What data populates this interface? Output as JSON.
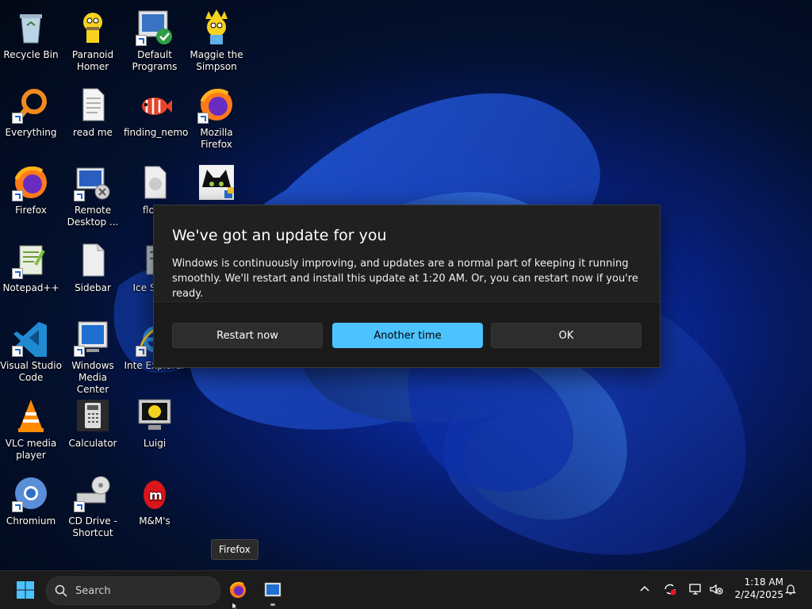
{
  "desktop": {
    "icons": [
      {
        "label": "Recycle Bin",
        "icon": "recycle-bin-icon"
      },
      {
        "label": "Paranoid Homer",
        "icon": "homer-icon"
      },
      {
        "label": "Default Programs",
        "icon": "default-programs-icon"
      },
      {
        "label": "Maggie the Simpson",
        "icon": "maggie-icon"
      },
      {
        "label": "Everything",
        "icon": "everything-search-icon"
      },
      {
        "label": "read me",
        "icon": "text-document-icon"
      },
      {
        "label": "finding_nemo",
        "icon": "nemo-fish-icon"
      },
      {
        "label": "Mozilla Firefox",
        "icon": "firefox-icon"
      },
      {
        "label": "Firefox",
        "icon": "firefox-icon"
      },
      {
        "label": "Remote Desktop ...",
        "icon": "remote-desktop-icon"
      },
      {
        "label": "flopp",
        "icon": "floppy-file-icon"
      },
      {
        "label": "",
        "icon": "cat-image-icon"
      },
      {
        "label": "Notepad++",
        "icon": "notepadpp-icon"
      },
      {
        "label": "Sidebar",
        "icon": "document-icon"
      },
      {
        "label": "Ice Scree",
        "icon": "ice-screen-icon"
      },
      {
        "label": "Visual Studio Code",
        "icon": "vscode-icon"
      },
      {
        "label": "Windows Media Center",
        "icon": "media-center-icon"
      },
      {
        "label": "Inte Explorer",
        "icon": "internet-explorer-icon"
      },
      {
        "label": "VLC media player",
        "icon": "vlc-icon"
      },
      {
        "label": "Calculator",
        "icon": "calculator-icon"
      },
      {
        "label": "Luigi",
        "icon": "luigi-monitor-icon"
      },
      {
        "label": "Chromium",
        "icon": "chromium-icon"
      },
      {
        "label": "CD Drive - Shortcut",
        "icon": "cd-drive-icon"
      },
      {
        "label": "M&M's",
        "icon": "mm-candy-icon"
      }
    ]
  },
  "dialog": {
    "title": "We've got an update for you",
    "body": "Windows is continuously improving, and updates are a normal part of keeping it running smoothly. We'll restart and install this update at 1:20 AM. Or, you can restart now if you're ready.",
    "buttons": {
      "restart_now": "Restart now",
      "another_time": "Another time",
      "ok": "OK"
    },
    "accent": "#4cc2ff"
  },
  "tooltip": {
    "text": "Firefox"
  },
  "taskbar": {
    "search_placeholder": "Search",
    "apps": [
      {
        "name": "Firefox",
        "icon": "firefox-icon"
      },
      {
        "name": "Windows Media Center",
        "icon": "media-center-icon"
      }
    ],
    "tray": [
      "chevron-up-icon",
      "sync-error-icon",
      "network-icon",
      "volume-muted-icon"
    ],
    "clock": {
      "time": "1:18 AM",
      "date": "2/24/2025"
    }
  },
  "colors": {
    "wallpaper_blue": "#0b3fd0",
    "taskbar_bg": "#1c1c1c",
    "dialog_bg": "#202020"
  }
}
